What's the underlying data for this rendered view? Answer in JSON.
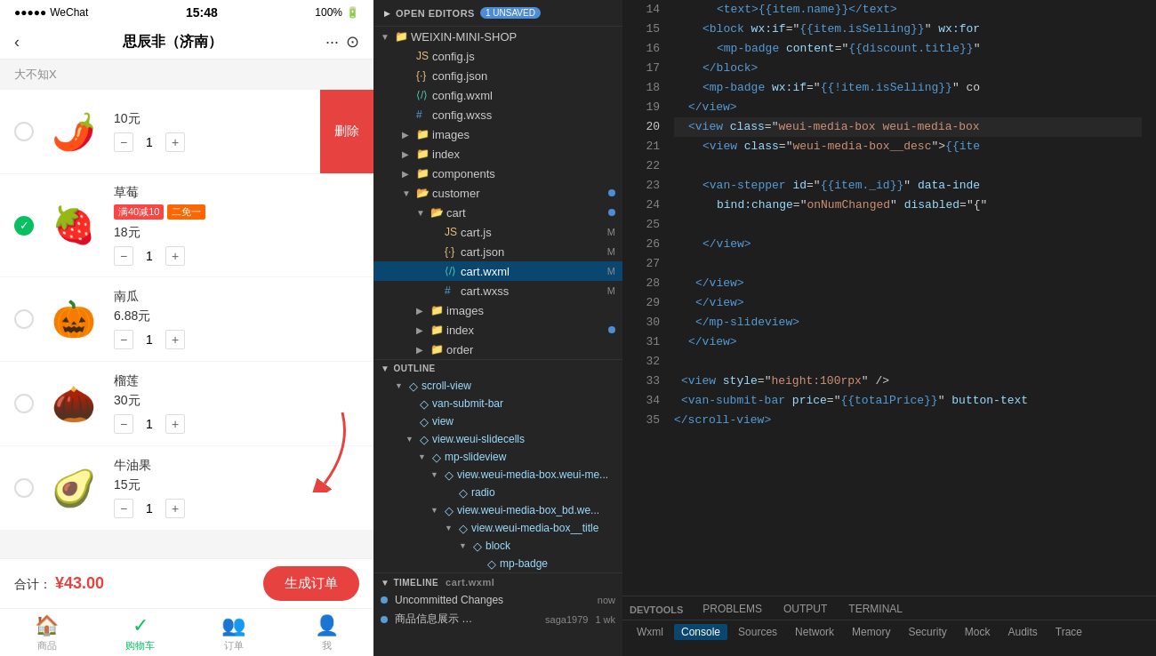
{
  "phone": {
    "status": {
      "signal": "●●●●●",
      "network": "WeChat",
      "wifi": "WiFi↑",
      "time": "15:48",
      "battery": "100%"
    },
    "nav": {
      "title": "思辰非（济南）",
      "back_icon": "‹",
      "more_icon": "···",
      "record_icon": "⊙"
    },
    "section_label": "大不知X",
    "items": [
      {
        "id": 1,
        "name": "大不知X",
        "price": "10元",
        "quantity": 1,
        "emoji": "🌶️",
        "checked": false,
        "show_delete": true,
        "delete_label": "删除",
        "tags": []
      },
      {
        "id": 2,
        "name": "草莓",
        "price": "18元",
        "quantity": 1,
        "emoji": "🍓",
        "checked": true,
        "show_delete": false,
        "tags": [
          {
            "text": "满40减10",
            "type": "red"
          },
          {
            "text": "二免一",
            "type": "green"
          }
        ]
      },
      {
        "id": 3,
        "name": "南瓜",
        "price": "6.88元",
        "quantity": 1,
        "emoji": "🎃",
        "checked": false,
        "show_delete": false,
        "tags": []
      },
      {
        "id": 4,
        "name": "榴莲",
        "price": "30元",
        "quantity": 1,
        "emoji": "🌰",
        "checked": false,
        "show_delete": false,
        "tags": []
      },
      {
        "id": 5,
        "name": "牛油果",
        "price": "15元",
        "quantity": 1,
        "emoji": "🥑",
        "checked": false,
        "show_delete": false,
        "tags": []
      }
    ],
    "bottom_bar": {
      "total_label": "合计：",
      "currency": "¥",
      "amount": "43",
      "decimal": ".00",
      "order_btn": "生成订单"
    },
    "tabs": [
      {
        "label": "商品",
        "icon": "🏠",
        "active": false
      },
      {
        "label": "购物车",
        "icon": "✓",
        "active": true
      },
      {
        "label": "订单",
        "icon": "👥",
        "active": false
      },
      {
        "label": "我",
        "icon": "👤",
        "active": false
      }
    ]
  },
  "explorer": {
    "open_editors_label": "OPEN EDITORS",
    "unsaved_badge": "1 UNSAVED",
    "project_name": "WEIXIN-MINI-SHOP",
    "files": [
      {
        "name": "config.js",
        "type": "js",
        "indent": 1
      },
      {
        "name": "config.json",
        "type": "json",
        "indent": 1
      },
      {
        "name": "config.wxml",
        "type": "wxml",
        "indent": 1
      },
      {
        "name": "config.wxss",
        "type": "wxss",
        "indent": 1
      },
      {
        "name": "images",
        "type": "folder",
        "indent": 1,
        "collapsed": true
      },
      {
        "name": "index",
        "type": "folder",
        "indent": 1,
        "collapsed": true
      },
      {
        "name": "components",
        "type": "folder",
        "indent": 1,
        "collapsed": true
      },
      {
        "name": "customer",
        "type": "folder_open",
        "indent": 1,
        "collapsed": false
      },
      {
        "name": "cart",
        "type": "folder_open",
        "indent": 2,
        "collapsed": false
      },
      {
        "name": "cart.js",
        "type": "js",
        "indent": 3,
        "mod": "M"
      },
      {
        "name": "cart.json",
        "type": "json",
        "indent": 3,
        "mod": "M"
      },
      {
        "name": "cart.wxml",
        "type": "wxml",
        "indent": 3,
        "active": true,
        "mod": "M"
      },
      {
        "name": "cart.wxss",
        "type": "wxss",
        "indent": 3,
        "mod": "M"
      },
      {
        "name": "images",
        "type": "folder",
        "indent": 2,
        "collapsed": true
      },
      {
        "name": "index",
        "type": "folder",
        "indent": 2,
        "collapsed": true
      },
      {
        "name": "order",
        "type": "folder",
        "indent": 2,
        "collapsed": true
      }
    ],
    "outline_label": "OUTLINE",
    "outline_items": [
      {
        "name": "scroll-view",
        "indent": 1,
        "icon": "◇"
      },
      {
        "name": "van-submit-bar",
        "indent": 2,
        "icon": "◇"
      },
      {
        "name": "view",
        "indent": 2,
        "icon": "◇"
      },
      {
        "name": "view.weui-slidecells",
        "indent": 2,
        "icon": "◇"
      },
      {
        "name": "mp-slideview",
        "indent": 3,
        "icon": "◇"
      },
      {
        "name": "view.weui-media-box.weui-me...",
        "indent": 4,
        "icon": "◇"
      },
      {
        "name": "radio",
        "indent": 5,
        "icon": "◇"
      },
      {
        "name": "view.weui-media-box_bd.we...",
        "indent": 4,
        "icon": "◇"
      },
      {
        "name": "view.weui-media-box__title",
        "indent": 5,
        "icon": "◇"
      },
      {
        "name": "block",
        "indent": 6,
        "icon": "◇"
      },
      {
        "name": "mp-badge",
        "indent": 7,
        "icon": "◇"
      }
    ],
    "timeline_label": "TIMELINE",
    "timeline_file": "cart.wxml",
    "timeline_items": [
      {
        "msg": "Uncommitted Changes",
        "time": "now",
        "author": ""
      },
      {
        "msg": "商品信息展示 …",
        "author": "saga1979",
        "time": "1 wk"
      }
    ]
  },
  "editor": {
    "lines": [
      {
        "num": 14,
        "content": "<text>{{item.name}}</text>",
        "tokens": [
          {
            "t": "tag",
            "v": "<text>"
          },
          {
            "t": "mustache",
            "v": "{{item.name}}"
          },
          {
            "t": "tag",
            "v": "</text>"
          }
        ]
      },
      {
        "num": 15,
        "content": "<block wx:if=\"{{item.isSelling}}\" wx:for",
        "tokens": [
          {
            "t": "tag",
            "v": "<block "
          },
          {
            "t": "attr",
            "v": "wx:if"
          },
          {
            "t": "text",
            "v": "=\""
          },
          {
            "t": "mustache",
            "v": "{{item.isSelling}}"
          },
          {
            "t": "text",
            "v": "\" "
          },
          {
            "t": "attr",
            "v": "wx:for"
          }
        ]
      },
      {
        "num": 16,
        "content": "  <mp-badge content=\"{{discount.title}}\"",
        "tokens": [
          {
            "t": "tag",
            "v": "<mp-badge "
          },
          {
            "t": "attr",
            "v": "content"
          },
          {
            "t": "text",
            "v": "=\""
          },
          {
            "t": "mustache",
            "v": "{{discount.title}}"
          },
          {
            "t": "text",
            "v": "\""
          }
        ]
      },
      {
        "num": 17,
        "content": "</block>",
        "tokens": [
          {
            "t": "tag",
            "v": "</block>"
          }
        ]
      },
      {
        "num": 18,
        "content": "<mp-badge wx:if=\"{{!item.isSelling}}\" co",
        "tokens": [
          {
            "t": "tag",
            "v": "<mp-badge "
          },
          {
            "t": "attr",
            "v": "wx:if"
          },
          {
            "t": "text",
            "v": "=\""
          },
          {
            "t": "mustache",
            "v": "{{!item.isSelling}}"
          },
          {
            "t": "text",
            "v": "\" co"
          }
        ]
      },
      {
        "num": 19,
        "content": "</view>",
        "tokens": [
          {
            "t": "tag",
            "v": "</view>"
          }
        ]
      },
      {
        "num": 20,
        "content": "<view class=\"weui-media-box weui-media-box",
        "tokens": [
          {
            "t": "tag",
            "v": "<view "
          },
          {
            "t": "attr",
            "v": "class"
          },
          {
            "t": "text",
            "v": "=\""
          },
          {
            "t": "string",
            "v": "weui-media-box weui-media-box"
          },
          {
            "t": "text",
            "v": "\""
          }
        ]
      },
      {
        "num": 21,
        "content": "  <view class=\"weui-media-box__desc\">{{ite",
        "tokens": [
          {
            "t": "tag",
            "v": "<view "
          },
          {
            "t": "attr",
            "v": "class"
          },
          {
            "t": "text",
            "v": "=\""
          },
          {
            "t": "string",
            "v": "weui-media-box__desc"
          },
          {
            "t": "text",
            "v": "\">"
          },
          {
            "t": "mustache",
            "v": "{{ite"
          }
        ]
      },
      {
        "num": 22,
        "content": "",
        "tokens": []
      },
      {
        "num": 23,
        "content": "  <van-stepper id=\"{{item._id}}\" data-inde",
        "tokens": [
          {
            "t": "tag",
            "v": "<van-stepper "
          },
          {
            "t": "attr",
            "v": "id"
          },
          {
            "t": "text",
            "v": "=\""
          },
          {
            "t": "mustache",
            "v": "{{item._id}}"
          },
          {
            "t": "text",
            "v": "\" "
          },
          {
            "t": "attr",
            "v": "data-inde"
          }
        ]
      },
      {
        "num": 24,
        "content": "    bind:change=\"onNumChanged\" disabled=\"{",
        "tokens": [
          {
            "t": "attr",
            "v": "bind:change"
          },
          {
            "t": "text",
            "v": "=\""
          },
          {
            "t": "string",
            "v": "onNumChanged"
          },
          {
            "t": "text",
            "v": "\" "
          },
          {
            "t": "attr",
            "v": "disabled"
          },
          {
            "t": "text",
            "v": "=\"{"
          }
        ]
      },
      {
        "num": 25,
        "content": "",
        "tokens": []
      },
      {
        "num": 26,
        "content": "</view>",
        "tokens": [
          {
            "t": "tag",
            "v": "</view>"
          }
        ]
      },
      {
        "num": 27,
        "content": "",
        "tokens": []
      },
      {
        "num": 28,
        "content": "  </view>",
        "tokens": [
          {
            "t": "tag",
            "v": "</view>"
          }
        ]
      },
      {
        "num": 29,
        "content": "  </view>",
        "tokens": [
          {
            "t": "tag",
            "v": "</view>"
          }
        ]
      },
      {
        "num": 30,
        "content": "  </mp-slideview>",
        "tokens": [
          {
            "t": "tag",
            "v": "</mp-slideview>"
          }
        ]
      },
      {
        "num": 31,
        "content": "</view>",
        "tokens": [
          {
            "t": "tag",
            "v": "</view>"
          }
        ]
      },
      {
        "num": 32,
        "content": "",
        "tokens": []
      },
      {
        "num": 33,
        "content": "<view style=\"height:100rpx\" />",
        "tokens": [
          {
            "t": "tag",
            "v": "<view "
          },
          {
            "t": "attr",
            "v": "style"
          },
          {
            "t": "text",
            "v": "=\""
          },
          {
            "t": "string",
            "v": "height:100rpx"
          },
          {
            "t": "text",
            "v": "\" />"
          }
        ]
      },
      {
        "num": 34,
        "content": "<van-submit-bar price=\"{{totalPrice}}\" button-text",
        "tokens": [
          {
            "t": "tag",
            "v": "<van-submit-bar "
          },
          {
            "t": "attr",
            "v": "price"
          },
          {
            "t": "text",
            "v": "=\""
          },
          {
            "t": "mustache",
            "v": "{{totalPrice}}"
          },
          {
            "t": "text",
            "v": "\" "
          },
          {
            "t": "attr",
            "v": "button-text"
          }
        ]
      },
      {
        "num": 35,
        "content": "</scroll-view>",
        "tokens": [
          {
            "t": "tag",
            "v": "</scroll-view>"
          }
        ]
      }
    ]
  },
  "devtools": {
    "label": "DEVTOOLS",
    "tabs": [
      {
        "label": "PROBLEMS",
        "active": false
      },
      {
        "label": "OUTPUT",
        "active": false
      },
      {
        "label": "TERMINAL",
        "active": false
      }
    ],
    "subtabs": [
      {
        "label": "Wxml",
        "active": false
      },
      {
        "label": "Console",
        "active": true
      },
      {
        "label": "Sources",
        "active": false
      },
      {
        "label": "Network",
        "active": false
      },
      {
        "label": "Memory",
        "active": false
      },
      {
        "label": "Security",
        "active": false
      },
      {
        "label": "Mock",
        "active": false
      },
      {
        "label": "Audits",
        "active": false
      },
      {
        "label": "Trace",
        "active": false
      }
    ]
  }
}
